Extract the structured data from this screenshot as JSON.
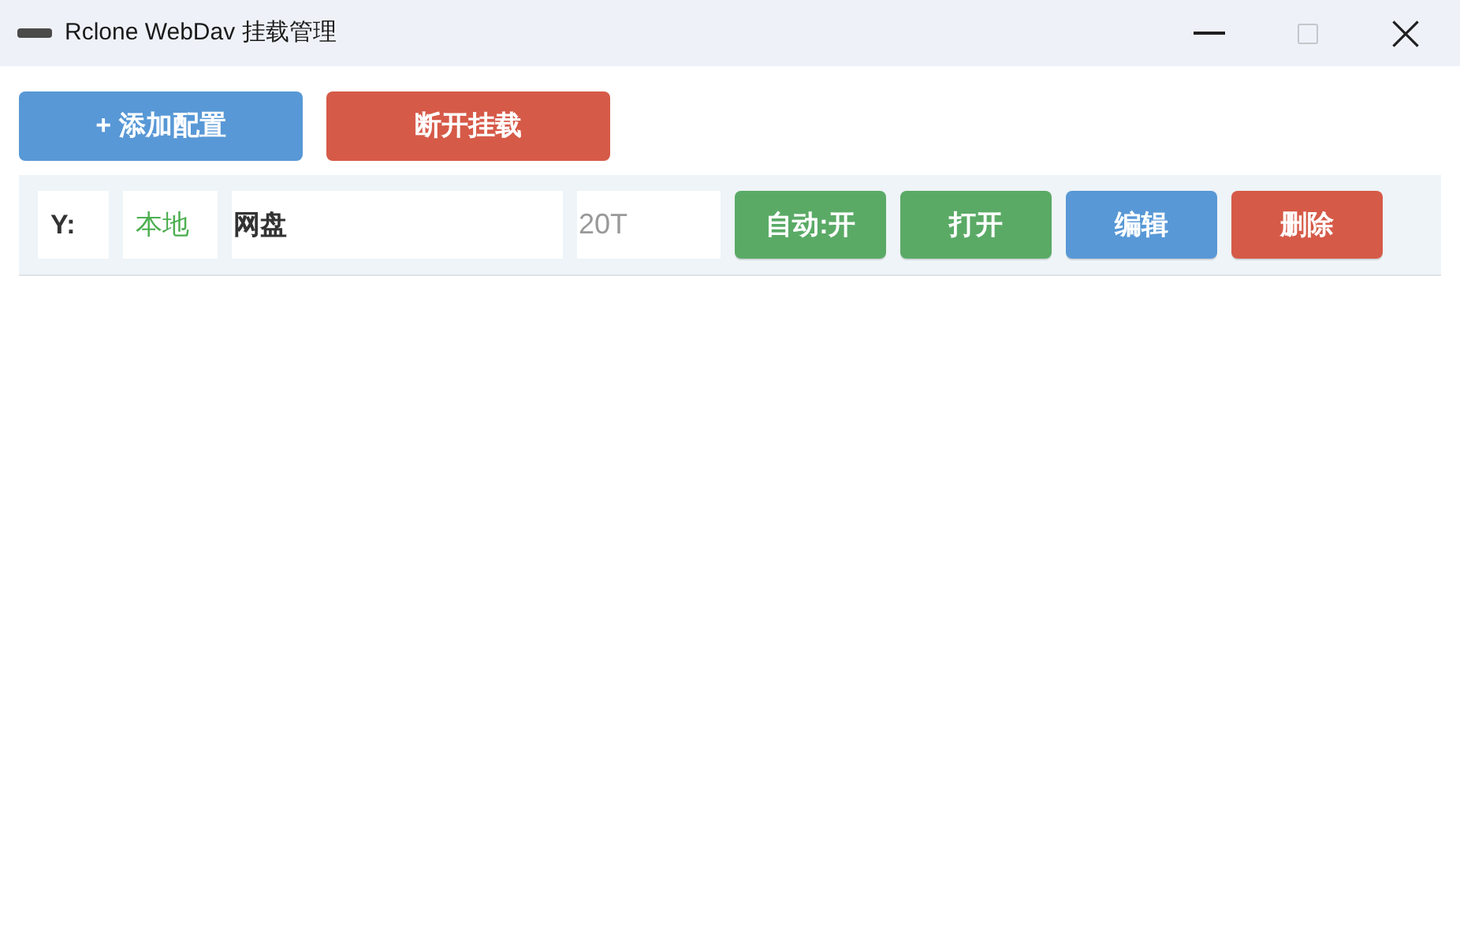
{
  "window": {
    "title": "Rclone WebDav 挂载管理",
    "controls": [
      {
        "kind": "minimize",
        "disabled": false
      },
      {
        "kind": "maximize",
        "disabled": true
      },
      {
        "kind": "close",
        "disabled": false
      }
    ]
  },
  "toolbar": [
    {
      "kind": "add",
      "label": "+ 添加配置"
    },
    {
      "kind": "disconnect",
      "label": "断开挂载"
    }
  ],
  "mounts": [
    {
      "drive": "Y:",
      "type": "本地",
      "name": "网盘",
      "capacity": "20T",
      "auto": {
        "label": "自动:开",
        "on": true
      },
      "actions": [
        {
          "kind": "open",
          "label": "打开"
        },
        {
          "kind": "edit",
          "label": "编辑"
        },
        {
          "kind": "delete",
          "label": "删除"
        }
      ]
    }
  ]
}
